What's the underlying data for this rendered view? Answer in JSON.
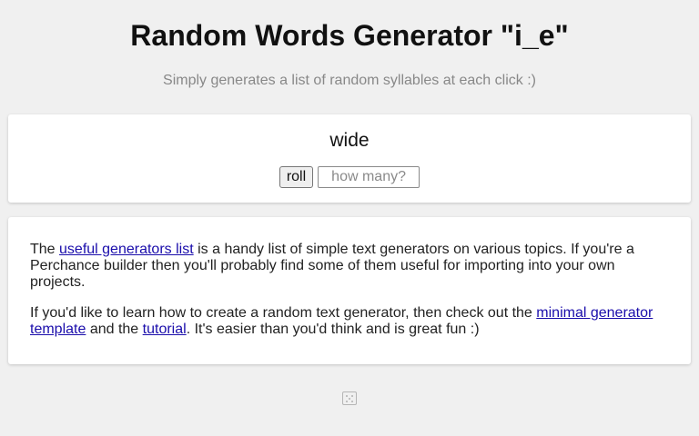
{
  "header": {
    "title": "Random Words Generator \"i_e\"",
    "subtitle": "Simply generates a list of random syllables at each click :)"
  },
  "generator": {
    "output": "wide",
    "roll_label": "roll",
    "count_placeholder": "how many?"
  },
  "info": {
    "p1_prefix": "The ",
    "p1_link": "useful generators list",
    "p1_suffix": " is a handy list of simple text generators on various topics. If you're a Perchance builder then you'll probably find some of them useful for importing into your own projects.",
    "p2_prefix": "If you'd like to learn how to create a random text generator, then check out the ",
    "p2_link1": "minimal generator template",
    "p2_middle": " and the ",
    "p2_link2": "tutorial",
    "p2_suffix": ". It's easier than you'd think and is great fun :)"
  },
  "footer": {
    "icon": "dice-icon"
  },
  "colors": {
    "background": "#f0f0f0",
    "card": "#ffffff",
    "link": "#1a0dab",
    "subtitle": "#888888"
  }
}
